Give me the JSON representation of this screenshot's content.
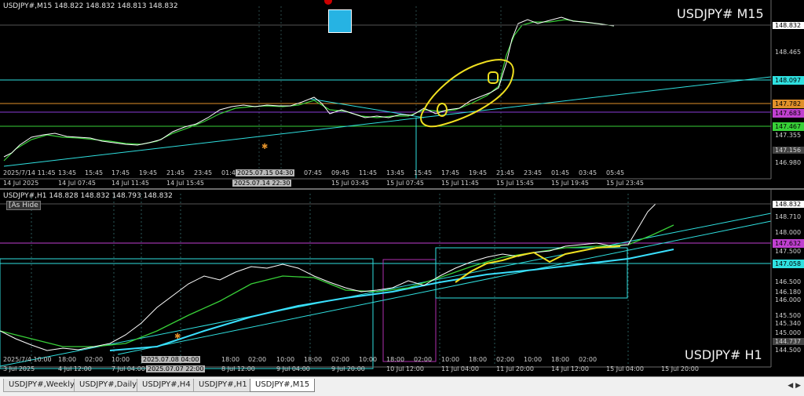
{
  "pane1": {
    "symbol_line": "USDJPY#,M15  148.822 148.832 148.813 148.832",
    "big_title": "USDJPY# M15",
    "price_labels": [
      "148.832",
      "148.465",
      "148.097",
      "147.782",
      "147.683",
      "147.467",
      "147.355",
      "147.156",
      "146.980"
    ],
    "x_ticks": [
      "2025/7/14 11:45",
      "13:45",
      "15:45",
      "17:45",
      "19:45",
      "21:45",
      "23:45",
      "01:45",
      "05:45",
      "07:45",
      "09:45",
      "11:45",
      "13:45",
      "15:45",
      "17:45",
      "19:45",
      "21:45",
      "23:45",
      "01:45",
      "03:45",
      "05:45"
    ],
    "x_ticks_bottom": [
      "14 Jul 2025",
      "14 Jul 07:45",
      "14 Jul 11:45",
      "14 Jul 15:45",
      "15 Jul 03:45",
      "15 Jul 07:45",
      "15 Jul 11:45",
      "15 Jul 15:45",
      "15 Jul 19:45",
      "15 Jul 23:45"
    ],
    "highlight_1": "2025.07.15 04:30",
    "highlight_2": "2025.07.14 22:30",
    "colors": {
      "cyan_line": "#2fe0e0",
      "orange_line": "#e0902a",
      "magenta_line": "#8a3bd6",
      "green_line": "#38d038",
      "yellow_mark": "#f0e020"
    }
  },
  "pane2": {
    "symbol_line": "USDJPY#,H1  148.828 148.832 148.793 148.832",
    "hide_button": "[As Hide",
    "big_title": "USDJPY# H1",
    "price_labels": [
      "148.832",
      "148.710",
      "148.000",
      "147.500",
      "147.058",
      "146.500",
      "146.180",
      "146.000",
      "145.500",
      "145.340",
      "145.000",
      "144.737",
      "144.500"
    ],
    "price_tag_magenta": "147.632",
    "x_ticks": [
      "2025/7/4 10:00",
      "18:00",
      "02:00",
      "10:00",
      "18:00",
      "02:00",
      "10:00",
      "18:00",
      "02:00",
      "10:00",
      "18:00",
      "02:00",
      "10:00",
      "18:00",
      "02:00",
      "10:00",
      "18:00",
      "02:00",
      "10:00",
      "18:00",
      "02:00"
    ],
    "x_ticks_bottom": [
      "3 Jul 2025",
      "4 Jul 12:00",
      "7 Jul 04:00",
      "8 Jul 12:00",
      "9 Jul 04:00",
      "9 Jul 20:00",
      "10 Jul 12:00",
      "11 Jul 04:00",
      "11 Jul 20:00",
      "14 Jul 12:00",
      "15 Jul 04:00",
      "15 Jul 20:00"
    ],
    "highlight_1": "2025.07.08 04:00",
    "highlight_2": "2025.07.07 22:00"
  },
  "tabs": [
    "USDJPY#,Weekly",
    "USDJPY#,Daily",
    "USDJPY#,H4",
    "USDJPY#,H1",
    "USDJPY#,M15"
  ],
  "active_tab": "USDJPY#,M15"
}
